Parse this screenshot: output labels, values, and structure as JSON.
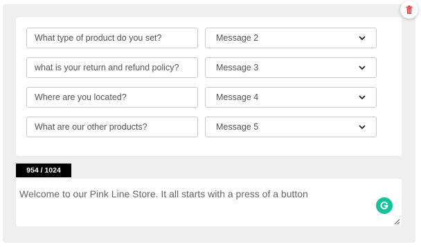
{
  "qa_rows": [
    {
      "question": "What type of product do you set?",
      "message": "Message 2"
    },
    {
      "question": "what is your return and refund policy?",
      "message": "Message 3"
    },
    {
      "question": "Where are you located?",
      "message": "Message 4"
    },
    {
      "question": "What are our other products?",
      "message": "Message 5"
    }
  ],
  "counter": "954 / 1024",
  "message_text": "Welcome to our Pink Line Store. It all starts with a press of a button",
  "colors": {
    "panel_bg": "#efefef",
    "delete_icon": "#e53935",
    "grammarly": "#15c39a",
    "counter_bg": "#000000"
  },
  "icons": {
    "delete": "trash-icon",
    "dropdown": "chevron-down-icon",
    "grammarly": "grammarly-icon",
    "resize": "resize-grip-icon"
  }
}
